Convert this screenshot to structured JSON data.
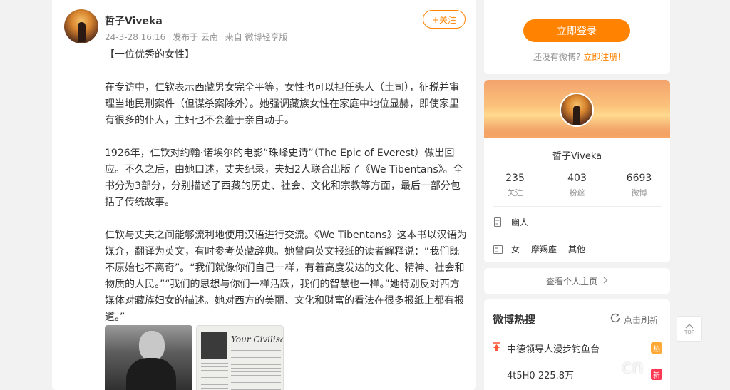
{
  "post": {
    "author": "哲子Viveka",
    "meta_time": "24-3-28 16:16",
    "meta_location": "发布于 云南",
    "meta_source": "来自 微博轻享版",
    "follow_label": "+关注",
    "paragraphs": [
      "【一位优秀的女性】",
      "在专访中，仁钦表示西藏男女完全平等，女性也可以担任头人（土司），征税并审理当地民刑案件（但谋杀案除外）。她强调藏族女性在家庭中地位显赫，即使家里有很多的仆人，主妇也不会羞于亲自动手。",
      "1926年，仁钦对约翰·诺埃尔的电影“珠峰史诗”（The Epic of Everest）做出回应。不久之后，由她口述，丈夫纪录，夫妇2人联合出版了《We Tibentans》。全书分为3部分，分别描述了西藏的历史、社会、文化和宗教等方面，最后一部分包括了传统故事。",
      "仁钦与丈夫之间能够流利地使用汉语进行交流。《We Tibentans》这本书以汉语为媒介，翻译为英文，有时参考英藏辞典。她曾向英文报纸的读者解释说：“我们既不原始也不离奇”。“我们就像你们自己一样，有着高度发达的文化、精神、社会和物质的人民。”“我们的思想与你们一样活跃，我们的智慧也一样。”她特别反对西方媒体对藏族妇女的描述。她对西方的美丽、文化和财富的看法在很多报纸上都有报道。”"
    ],
    "image2_caption": "Your Civilisati"
  },
  "login": {
    "button_label": "立即登录",
    "prompt": "还没有微博?",
    "register_label": "立即注册!"
  },
  "profile": {
    "name": "哲子Viveka",
    "stats": [
      {
        "num": "235",
        "label": "关注"
      },
      {
        "num": "403",
        "label": "粉丝"
      },
      {
        "num": "6693",
        "label": "微博"
      }
    ],
    "tag1": "幽人",
    "gender": "女",
    "zodiac": "摩羯座",
    "other": "其他"
  },
  "homepage_link": "查看个人主页",
  "hot": {
    "title": "微博热搜",
    "refresh_label": "点击刷新",
    "items": [
      {
        "text": "中德领导人漫步钓鱼台",
        "badge": "热"
      },
      {
        "text": "4t5H0  225.8万",
        "badge": "新"
      }
    ]
  },
  "top_button_label": "TOP",
  "watermark": "cn"
}
